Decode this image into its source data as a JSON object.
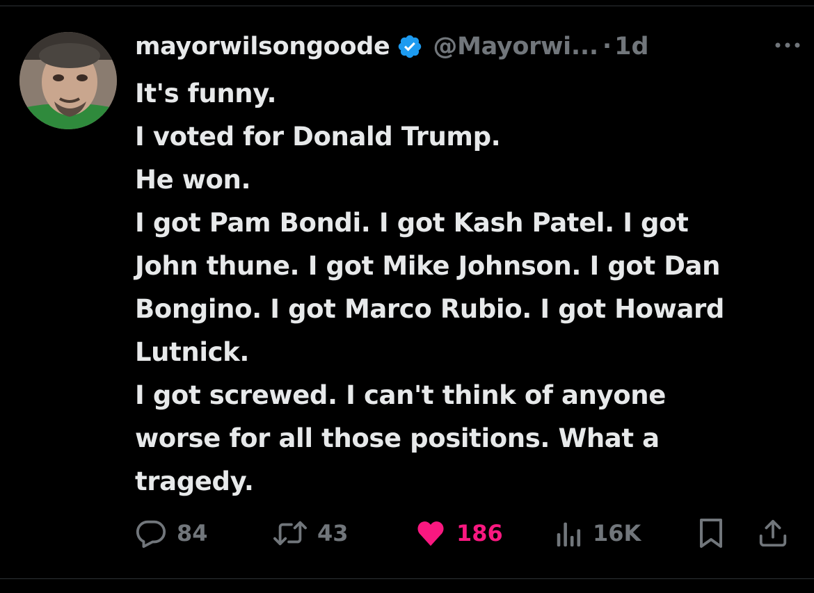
{
  "tweet": {
    "display_name": "mayorwilsongoode",
    "handle": "@Mayorwi...",
    "separator": "·",
    "time": "1d",
    "text_lines": [
      "It's funny.",
      "I voted for Donald Trump.",
      "He won.",
      "I got Pam Bondi. I got Kash Patel. I got",
      "John thune. I got Mike Johnson. I got Dan",
      "Bongino. I got Marco Rubio. I got Howard",
      "Lutnick.",
      "I got screwed. I can't think of anyone",
      "worse for all those positions. What a",
      "tragedy."
    ]
  },
  "actions": {
    "replies": "84",
    "retweets": "43",
    "likes": "186",
    "views": "16K"
  },
  "icons": {
    "verified": "verified-badge-icon",
    "more": "more-icon",
    "reply": "reply-icon",
    "retweet": "retweet-icon",
    "like": "heart-icon",
    "views": "views-icon",
    "bookmark": "bookmark-icon",
    "share": "share-icon"
  },
  "colors": {
    "background": "#000000",
    "text": "#e7e9ea",
    "muted": "#71767b",
    "verified": "#1d9bf0",
    "like": "#f91880"
  }
}
